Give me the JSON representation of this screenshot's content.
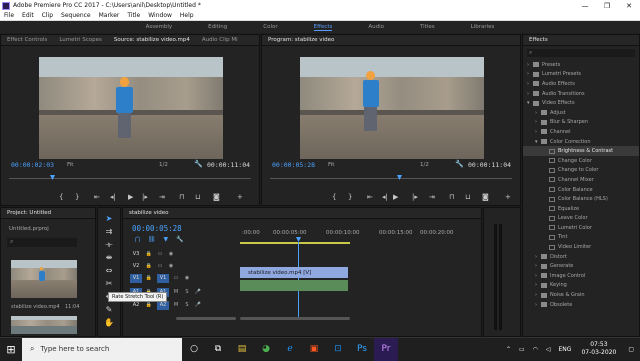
{
  "window": {
    "title": "Adobe Premiere Pro CC 2017 - C:\\Users\\anil\\Desktop\\Untitled *",
    "minimize": "—",
    "maximize": "❐",
    "close": "✕"
  },
  "menu": [
    "File",
    "Edit",
    "Clip",
    "Sequence",
    "Marker",
    "Title",
    "Window",
    "Help"
  ],
  "workspaces": [
    "Assembly",
    "Editing",
    "Color",
    "Effects",
    "Audio",
    "Titles",
    "Libraries"
  ],
  "workspace_active": "Effects",
  "source_panel": {
    "tabs": [
      "Effect Controls",
      "Lumetri Scopes",
      "Source: stabilize video.mp4",
      "Audio Clip Mi"
    ],
    "active_tab": "Source: stabilize video.mp4",
    "timecode_in": "00:00:02:03",
    "fit": "Fit",
    "ratio": "1/2",
    "timecode_out": "00:00:11:04"
  },
  "program_panel": {
    "tab": "Program: stabilize video",
    "timecode_in": "00:00:05:28",
    "fit": "Fit",
    "ratio": "1/2",
    "timecode_out": "00:00:11:04"
  },
  "project_panel": {
    "tab": "Project: Untitled",
    "file": "Untitled.prproj",
    "clip1_name": "stabilize video.mp4",
    "clip1_duration": "11:04"
  },
  "timeline": {
    "tab": "stabilize video",
    "timecode": "00:00:05:28",
    "ruler": [
      ":00:00",
      "00:00:05:00",
      "00:00:10:00",
      "00:00:15:00",
      "00:00:20:00"
    ],
    "video_tracks": [
      "V3",
      "V2",
      "V1"
    ],
    "audio_tracks": [
      "A1",
      "A2"
    ],
    "video_clip_label": "stabilize video.mp4 [V]",
    "tooltip": "Rate Stretch Tool (R)"
  },
  "effects_panel": {
    "title": "Effects",
    "items": [
      {
        "label": "Presets",
        "level": 0,
        "type": "folder"
      },
      {
        "label": "Lumetri Presets",
        "level": 0,
        "type": "folder"
      },
      {
        "label": "Audio Effects",
        "level": 0,
        "type": "folder"
      },
      {
        "label": "Audio Transitions",
        "level": 0,
        "type": "folder"
      },
      {
        "label": "Video Effects",
        "level": 0,
        "type": "folder-open"
      },
      {
        "label": "Adjust",
        "level": 1,
        "type": "folder"
      },
      {
        "label": "Blur & Sharpen",
        "level": 1,
        "type": "folder"
      },
      {
        "label": "Channel",
        "level": 1,
        "type": "folder"
      },
      {
        "label": "Color Correction",
        "level": 1,
        "type": "folder-open"
      },
      {
        "label": "Brightness & Contrast",
        "level": 2,
        "type": "effect",
        "selected": true
      },
      {
        "label": "Change Color",
        "level": 2,
        "type": "effect"
      },
      {
        "label": "Change to Color",
        "level": 2,
        "type": "effect"
      },
      {
        "label": "Channel Mixer",
        "level": 2,
        "type": "effect"
      },
      {
        "label": "Color Balance",
        "level": 2,
        "type": "effect"
      },
      {
        "label": "Color Balance (HLS)",
        "level": 2,
        "type": "effect"
      },
      {
        "label": "Equalize",
        "level": 2,
        "type": "effect"
      },
      {
        "label": "Leave Color",
        "level": 2,
        "type": "effect"
      },
      {
        "label": "Lumetri Color",
        "level": 2,
        "type": "effect"
      },
      {
        "label": "Tint",
        "level": 2,
        "type": "effect"
      },
      {
        "label": "Video Limiter",
        "level": 2,
        "type": "effect"
      },
      {
        "label": "Distort",
        "level": 1,
        "type": "folder"
      },
      {
        "label": "Generate",
        "level": 1,
        "type": "folder"
      },
      {
        "label": "Image Control",
        "level": 1,
        "type": "folder"
      },
      {
        "label": "Keying",
        "level": 1,
        "type": "folder"
      },
      {
        "label": "Noise & Grain",
        "level": 1,
        "type": "folder"
      },
      {
        "label": "Obsolete",
        "level": 1,
        "type": "folder"
      }
    ]
  },
  "taskbar": {
    "search_placeholder": "Type here to search",
    "lang": "ENG",
    "time": "07:53",
    "date": "07-03-2020"
  },
  "colors": {
    "accent": "#4ba3ff",
    "video_clip": "#8fa8e0",
    "audio_clip": "#5a8c5a"
  }
}
